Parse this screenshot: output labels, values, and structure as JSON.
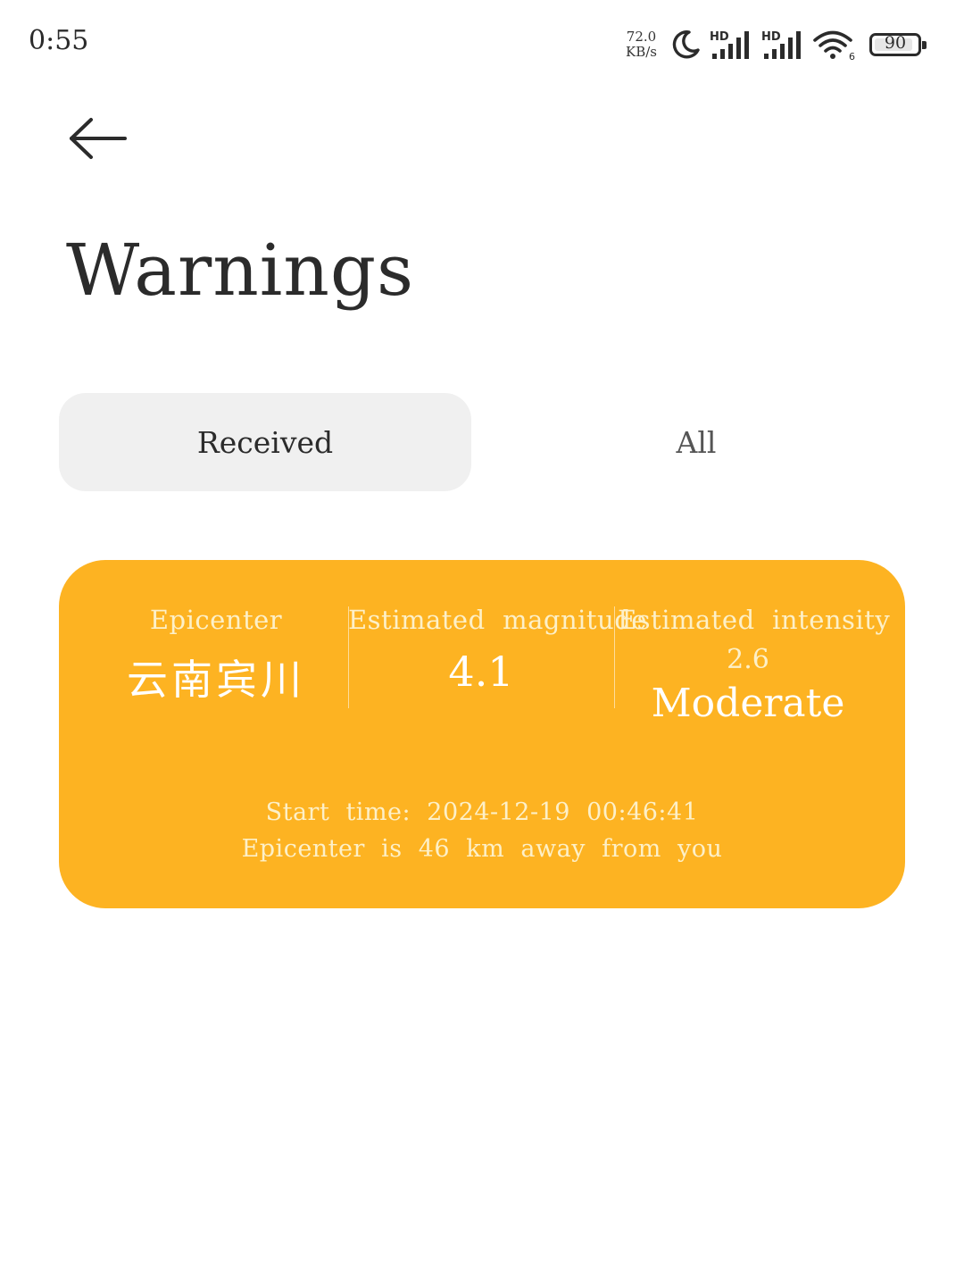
{
  "status_bar": {
    "time": "0:55",
    "net_speed_value": "72.0",
    "net_speed_unit": "KB/s",
    "signal_1_label": "HD",
    "signal_2_label": "HD",
    "wifi_badge": "6",
    "battery_level": "90",
    "icons": [
      "moon-icon",
      "signal-icon",
      "signal-icon",
      "wifi-icon",
      "battery-icon"
    ]
  },
  "header": {
    "back_icon": "arrow-left-icon",
    "title": "Warnings"
  },
  "tabs": [
    {
      "label": "Received",
      "selected": true
    },
    {
      "label": "All",
      "selected": false
    }
  ],
  "warning_card": {
    "background_color": "#fdb322",
    "epicenter_label": "Epicenter",
    "epicenter_value": "云南宾川",
    "magnitude_label": "Estimated  magnitude",
    "magnitude_value": "4.1",
    "intensity_label": "Estimated  intensity",
    "intensity_value": "2.6",
    "intensity_level": "Moderate",
    "start_time": "Start  time:  2024-12-19  00:46:41",
    "distance": "Epicenter  is  46  km  away  from  you"
  }
}
